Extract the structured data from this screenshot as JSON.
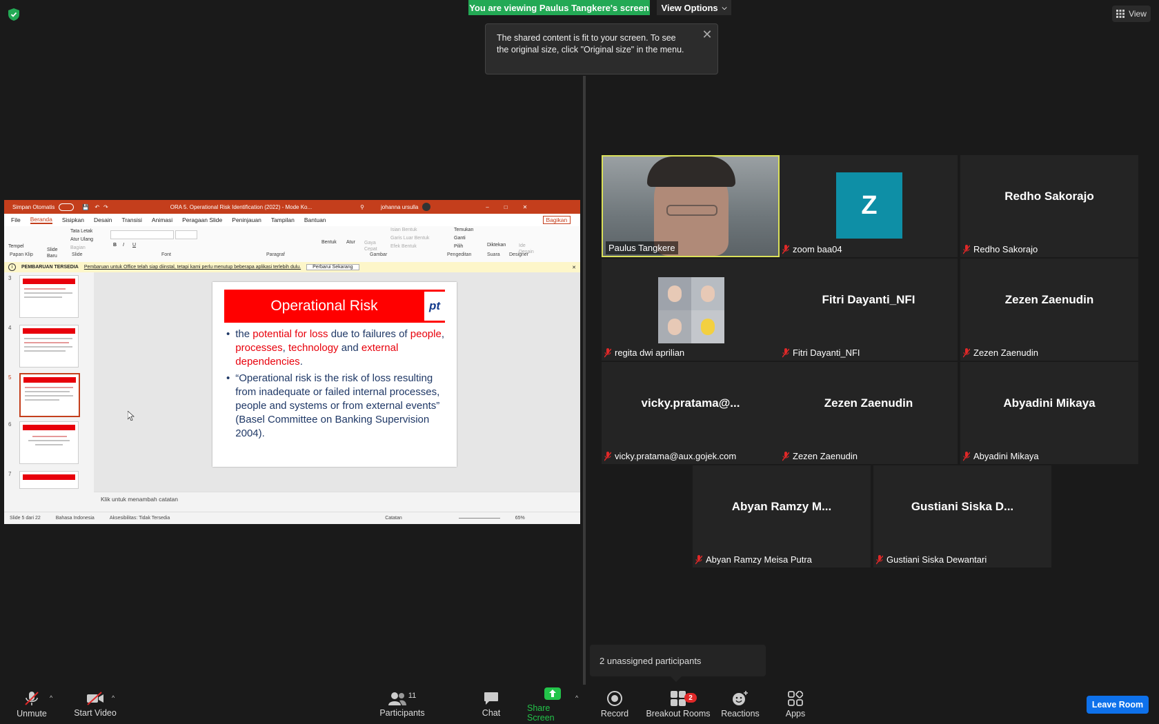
{
  "top": {
    "viewing_banner": "You are viewing Paulus Tangkere's screen",
    "view_options": "View Options",
    "view_button": "View",
    "fit_tooltip": "The shared content is fit to your screen. To see the original size, click \"Original size\" in the menu.",
    "tooltip_close": "✕"
  },
  "ppt": {
    "autosave": "Simpan Otomatis",
    "doc_title": "ORA 5. Operational Risk Identification (2022) - Mode Ko...",
    "user": "johanna ursulla",
    "tabs": [
      "File",
      "Beranda",
      "Sisipkan",
      "Desain",
      "Transisi",
      "Animasi",
      "Peragaan Slide",
      "Peninjauan",
      "Tampilan",
      "Bantuan"
    ],
    "share_label": "Bagikan",
    "ribbon_groups": [
      "Papan Klip",
      "Slide",
      "Font",
      "Paragraf",
      "Gambar",
      "Pengeditan",
      "Suara",
      "Designer"
    ],
    "ribbon_items": {
      "tempel": "Tempel",
      "slide_baru": "Slide Baru",
      "tata_letak": "Tata Letak",
      "atur_ulang": "Atur Ulang",
      "bagian": "Bagian",
      "bentuk": "Bentuk",
      "atur": "Atur",
      "gaya_cepat": "Gaya Cepat",
      "isian_bentuk": "Isian Bentuk",
      "garis_luar_bentuk": "Garis Luar Bentuk",
      "efek_bentuk": "Efek Bentuk",
      "temukan": "Temukan",
      "ganti": "Ganti",
      "pilih": "Pilih",
      "diktekan": "Diktekan",
      "ide_desain": "Ide Desain"
    },
    "notice_label": "PEMBARUAN TERSEDIA",
    "notice_text": "Pembaruan untuk Office telah siap diinstal, tetapi kami perlu menutup beberapa aplikasi terlebih dulu.",
    "notice_button": "Perbarui Sekarang",
    "thumb_numbers": [
      "3",
      "4",
      "5",
      "6",
      "7"
    ],
    "slide": {
      "title": "Operational Risk",
      "logo": "pt",
      "bullet1": {
        "a": "the ",
        "b": "potential for loss",
        "c": " due to failures of ",
        "d": "people",
        "e": ", ",
        "f": "processes",
        "g": ", ",
        "h": "technology",
        "i": " and ",
        "j": "external dependencies",
        "k": "."
      },
      "bullet2": "“Operational risk is the risk of loss resulting from inadequate or failed internal processes, people and systems or from external events” (Basel Committee on Banking Supervision 2004)."
    },
    "notes_placeholder": "Klik untuk menambah catatan",
    "status": {
      "slide": "Slide 5 dari 22",
      "language": "Bahasa Indonesia",
      "accessibility": "Aksesibilitas: Tidak Tersedia",
      "notes": "Catatan",
      "zoom": "65%"
    }
  },
  "participants": [
    {
      "display": "",
      "name": "Paulus Tangkere",
      "muted": false
    },
    {
      "display": "Z",
      "name": "zoom baa04",
      "muted": true
    },
    {
      "display": "Redho Sakorajo",
      "name": "Redho Sakorajo",
      "muted": true
    },
    {
      "display": "",
      "name": "regita dwi aprilian",
      "muted": true
    },
    {
      "display": "Fitri Dayanti_NFI",
      "name": "Fitri Dayanti_NFI",
      "muted": true
    },
    {
      "display": "Zezen Zaenudin",
      "name": "Zezen Zaenudin",
      "muted": true
    },
    {
      "display": "vicky.pratama@...",
      "name": "vicky.pratama@aux.gojek.com",
      "muted": true
    },
    {
      "display": "Zezen Zaenudin",
      "name": "Zezen Zaenudin",
      "muted": true
    },
    {
      "display": "Abyadini Mikaya",
      "name": "Abyadini Mikaya",
      "muted": true
    },
    {
      "display": "Abyan Ramzy M...",
      "name": "Abyan Ramzy Meisa Putra",
      "muted": true
    },
    {
      "display": "Gustiani Siska D...",
      "name": "Gustiani Siska Dewantari",
      "muted": true
    }
  ],
  "unassigned_popup": "2 unassigned participants",
  "toolbar": {
    "unmute": "Unmute",
    "start_video": "Start Video",
    "participants": "Participants",
    "participants_count": "11",
    "chat": "Chat",
    "share_screen": "Share Screen",
    "record": "Record",
    "breakout_rooms": "Breakout Rooms",
    "breakout_badge": "2",
    "reactions": "Reactions",
    "apps": "Apps",
    "leave_room": "Leave Room"
  },
  "colors": {
    "banner_green": "#23a955",
    "active_speaker_border": "#dbe15a",
    "share_green": "#23c44a",
    "leave_blue": "#0e71eb",
    "avatar_teal": "#0e8fa6",
    "ppt_red": "#c43e1c",
    "slide_red": "#ff0000"
  }
}
